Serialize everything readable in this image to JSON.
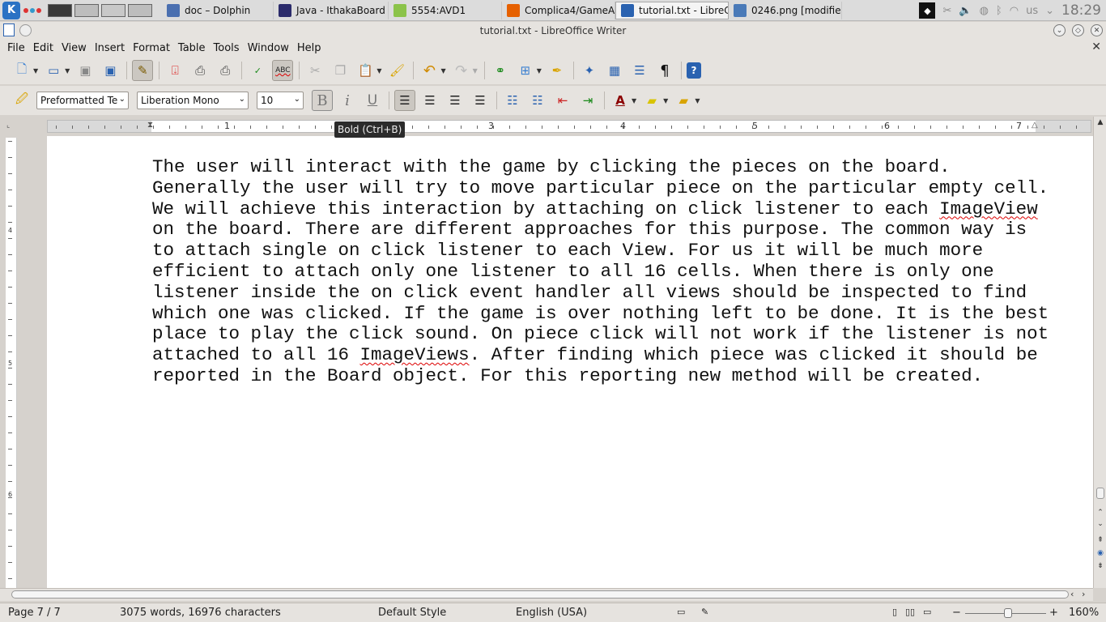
{
  "taskbar": {
    "tasks": [
      {
        "label": "doc – Dolphin",
        "icon": "dolphin-folder-icon",
        "color": "#4a6fb0"
      },
      {
        "label": "Java - IthakaBoard",
        "icon": "eclipse-icon",
        "color": "#2b2b6b"
      },
      {
        "label": "5554:AVD1",
        "icon": "android-icon",
        "color": "#8bc34a"
      },
      {
        "label": "Complica4/GameA",
        "icon": "firefox-icon",
        "color": "#e66000"
      },
      {
        "label": "tutorial.txt - LibreC",
        "icon": "writer-doc-icon",
        "color": "#2a62b0"
      },
      {
        "label": "0246.png [modifie",
        "icon": "image-editor-icon",
        "color": "#4a7ab8"
      }
    ],
    "keyboard_layout": "us",
    "clock": "18:29"
  },
  "window": {
    "title": "tutorial.txt - LibreOffice Writer"
  },
  "menubar": {
    "items": [
      "File",
      "Edit",
      "View",
      "Insert",
      "Format",
      "Table",
      "Tools",
      "Window",
      "Help"
    ]
  },
  "formatting": {
    "paragraph_style": "Preformatted Te",
    "font_name": "Liberation Mono",
    "font_size": "10"
  },
  "tooltip": "Bold (Ctrl+B)",
  "ruler": {
    "numbers": [
      "1",
      "2",
      "3",
      "4",
      "5",
      "6",
      "7"
    ]
  },
  "vruler": {
    "numbers": [
      "4",
      "5",
      "6"
    ]
  },
  "document": {
    "segments": [
      {
        "text": "The user will interact with the game by clicking the pieces on the board. Generally the user will try to move particular piece on the particular empty cell. We will achieve this interaction by attaching on click listener to each ",
        "spell": false
      },
      {
        "text": "ImageView",
        "spell": true
      },
      {
        "text": " on the board. There are different approaches for this purpose. The common way is to attach single on click listener to each View. For us it will be much more efficient to attach only one listener to all 16 cells. When there is only one listener inside the on click event handler all views should be inspected to find which one was clicked. If the game is over nothing left to be done. It is the best place to play the click sound. On piece click will not work if the listener is not attached to all 16 ",
        "spell": false
      },
      {
        "text": "ImageViews",
        "spell": true
      },
      {
        "text": ". After finding which piece was clicked it should be reported in the Board object. For this reporting new method will be created.",
        "spell": false
      }
    ]
  },
  "statusbar": {
    "page": "Page 7 / 7",
    "wordcount": "3075 words, 16976 characters",
    "page_style": "Default Style",
    "language": "English (USA)",
    "zoom": "160%"
  }
}
